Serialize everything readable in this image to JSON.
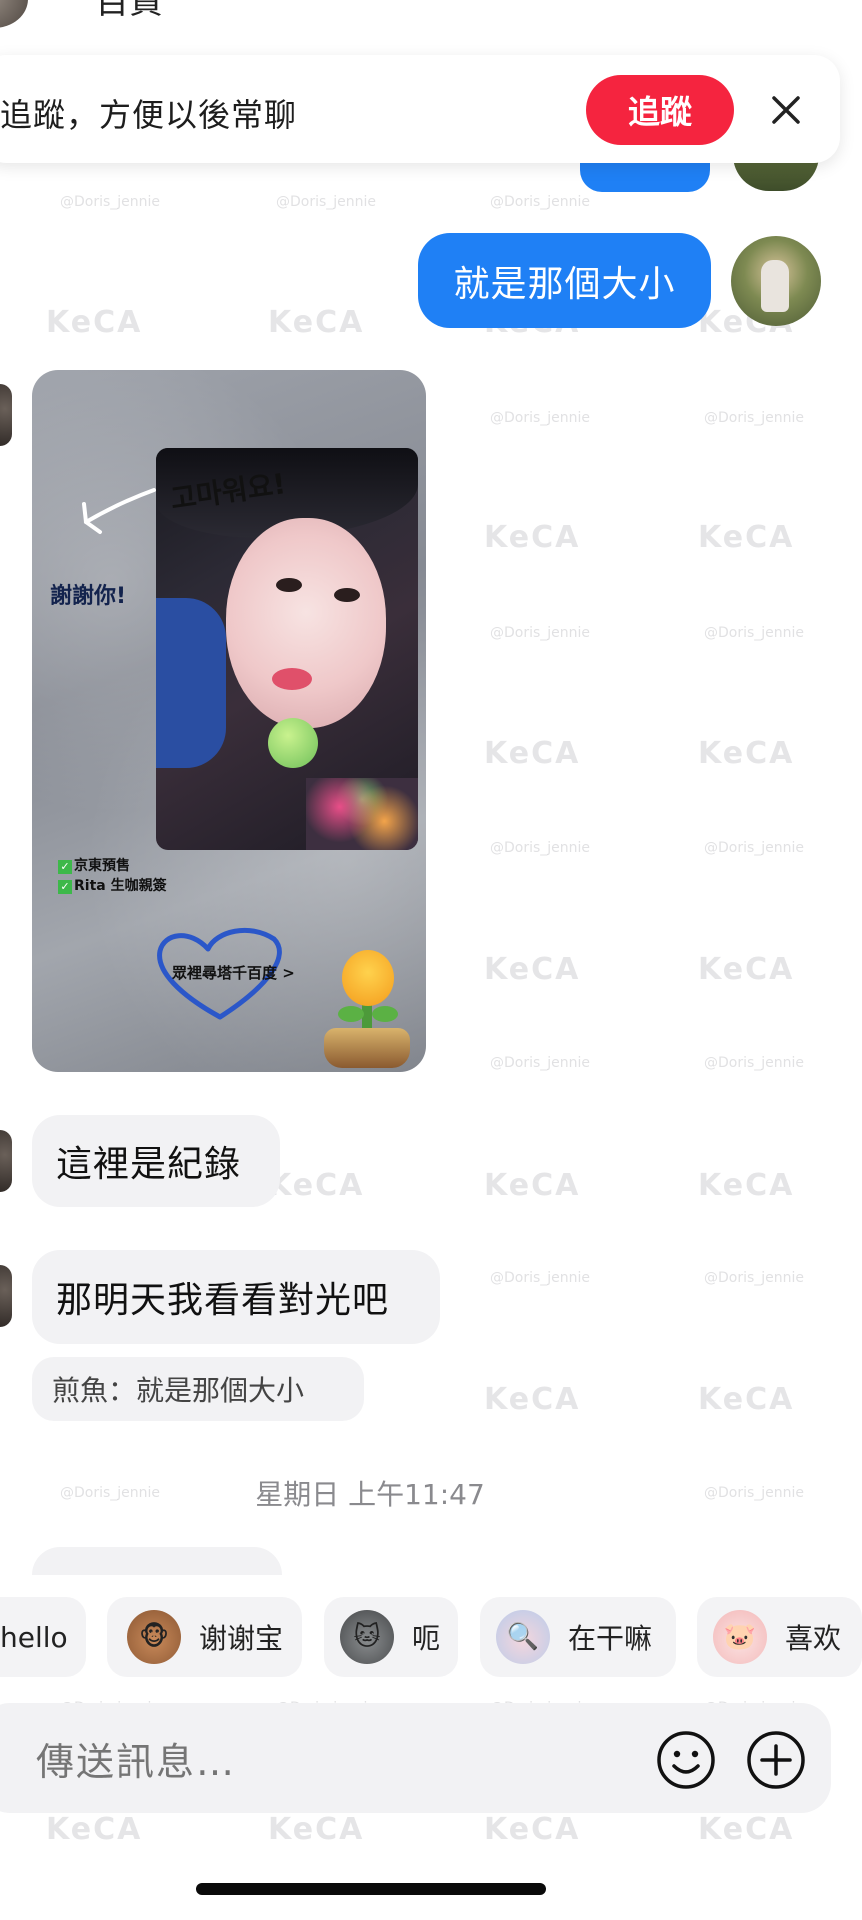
{
  "header": {
    "contact_name": "百貨"
  },
  "follow_banner": {
    "text": "追蹤，方便以後常聊",
    "follow_label": "追蹤"
  },
  "messages": {
    "sent_1": "就是那個大小",
    "photo_card": {
      "handwriting": "고마워요!",
      "thanks_text": "謝謝你!",
      "check_1": "京東預售",
      "check_2": "Rita 生咖親簽",
      "tag_text": "眾裡尋塔千百度 >"
    },
    "received_1": "這裡是紀錄",
    "received_2": "那明天我看看對光吧",
    "reply_quote": "煎魚：就是那個大小",
    "timestamp": "星期日 上午11:47"
  },
  "quick_replies": [
    {
      "label": "hello",
      "icon": "hello-sticker-icon"
    },
    {
      "label": "谢谢宝",
      "icon": "monkey-sticker-icon"
    },
    {
      "label": "呃",
      "icon": "cat-sticker-icon"
    },
    {
      "label": "在干嘛",
      "icon": "magnifier-sticker-icon"
    },
    {
      "label": "喜欢",
      "icon": "pig-sticker-icon"
    }
  ],
  "composer": {
    "placeholder": "傳送訊息…"
  },
  "watermark": {
    "brand": "KeCA",
    "handle": "@Doris_jennie"
  },
  "colors": {
    "accent_blue": "#1f80f5",
    "follow_red": "#f5243f",
    "bubble_gray": "#f2f2f4"
  }
}
